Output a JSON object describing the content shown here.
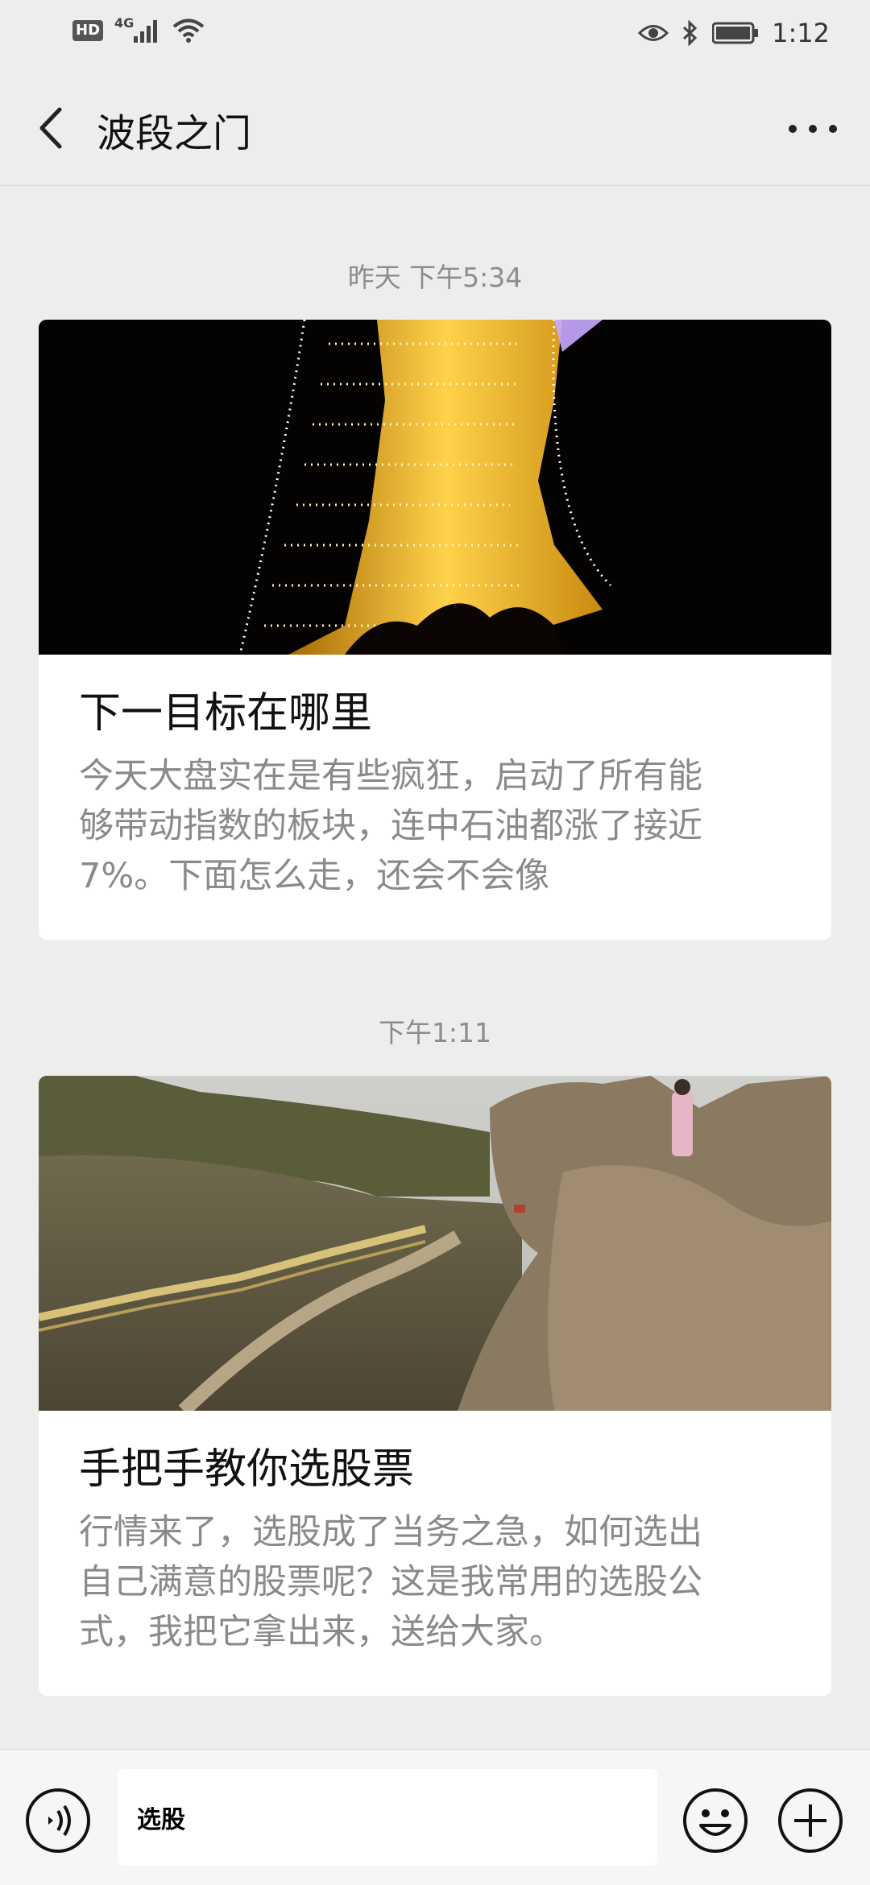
{
  "status_bar": {
    "hd": "HD",
    "network": "4G",
    "time": "1:12"
  },
  "header": {
    "title": "波段之门",
    "back_icon": "chevron-left-icon",
    "more_icon": "more-dots-icon"
  },
  "messages": [
    {
      "timestamp": "昨天 下午5:34",
      "title": "下一目标在哪里",
      "desc_lines": [
        "今天大盘实在是有些疯狂，启动了所有能",
        "够带动指数的板块，连中石油都涨了接近",
        "7%。下面怎么走，还会不会像"
      ]
    },
    {
      "timestamp": "下午1:11",
      "title": "手把手教你选股票",
      "desc_lines": [
        "行情来了，选股成了当务之急，如何选出",
        "自己满意的股票呢？这是我常用的选股公",
        "式，我把它拿出来，送给大家。"
      ]
    }
  ],
  "input": {
    "value": "选股"
  },
  "colors": {
    "background": "#ededed",
    "card": "#ffffff",
    "muted_text": "#8a8a8a"
  }
}
